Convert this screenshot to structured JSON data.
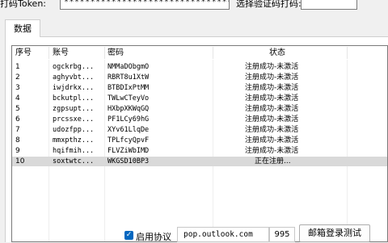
{
  "top": {
    "token_label": "打码Token:",
    "token_value": "*******************************************",
    "captcha_label": "选择验证码打码:"
  },
  "tab": {
    "label": "数据"
  },
  "table": {
    "columns": [
      "序号",
      "账号",
      "密码",
      "状态"
    ],
    "rows": [
      {
        "no": "1",
        "account": "ogckrbg...",
        "password": "NMMaDObgmO",
        "status": "注册成功-未激活"
      },
      {
        "no": "2",
        "account": "aghyvbt...",
        "password": "RBRT8u1XtW",
        "status": "注册成功-未激活"
      },
      {
        "no": "3",
        "account": "iwjdrkx...",
        "password": "BTBDIxPtMM",
        "status": "注册成功-未激活"
      },
      {
        "no": "4",
        "account": "bckutpl...",
        "password": "TWLwCTeyVo",
        "status": "注册成功-未激活"
      },
      {
        "no": "5",
        "account": "zgpsupt...",
        "password": "HXbpXKWqGQ",
        "status": "注册成功-未激活"
      },
      {
        "no": "6",
        "account": "prcssxe...",
        "password": "PF1LCy69hG",
        "status": "注册成功-未激活"
      },
      {
        "no": "7",
        "account": "udozfpp...",
        "password": "XYv61LlqDe",
        "status": "注册成功-未激活"
      },
      {
        "no": "8",
        "account": "mmxpthz...",
        "password": "TPLfcyQpvF",
        "status": "注册成功-未激活"
      },
      {
        "no": "9",
        "account": "hqifmih...",
        "password": "FLVZiWbIMD",
        "status": "注册成功-未激活"
      },
      {
        "no": "10",
        "account": "soxtwtc...",
        "password": "WKGSD10BP3",
        "status": "正在注册..."
      }
    ],
    "selected_row": 9
  },
  "bottom": {
    "protocol_checked": true,
    "protocol_label": "启用协议",
    "domain_value": "pop.outlook.com",
    "port_value": "995",
    "test_button_label": "邮箱登录测试"
  },
  "colors": {
    "accent": "#0067c0",
    "selected_row": "#d9d9d9"
  },
  "icons": {
    "check": "check-icon"
  }
}
